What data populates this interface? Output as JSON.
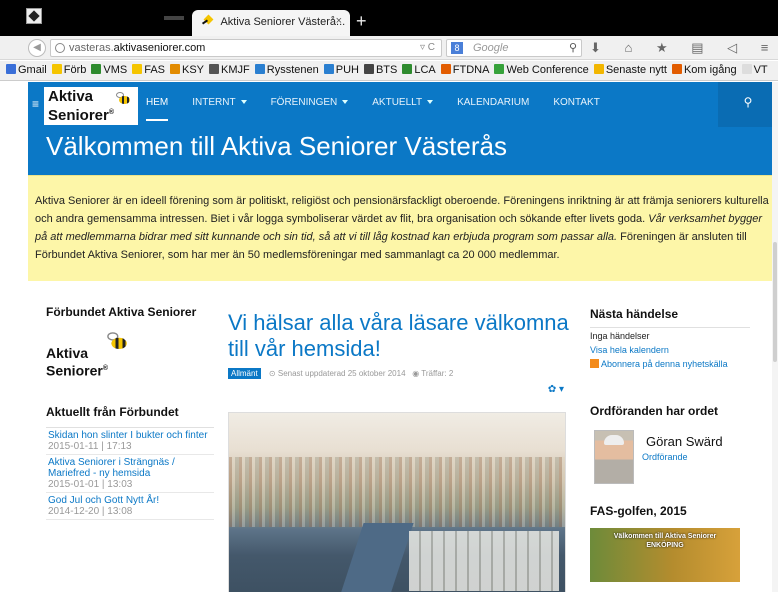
{
  "browser": {
    "tab_title": "Aktiva Seniorer Västerå...",
    "tab_close": "×",
    "new_tab": "+",
    "url_prefix": "vasteras.",
    "url_domain": "aktivaseniorer.com",
    "url_right": "▿ C",
    "search_placeholder": "Google",
    "search_engine_letter": "8",
    "tool_icons": "⬇ ⌂ ★ ▤ ◁ ≡"
  },
  "bookmarks": [
    {
      "label": "Gmail",
      "color": "#3a6fd8"
    },
    {
      "label": "Förb",
      "color": "#f5c500"
    },
    {
      "label": "VMS",
      "color": "#2e8b2e"
    },
    {
      "label": "FAS",
      "color": "#f5c500"
    },
    {
      "label": "KSY",
      "color": "#e28b00"
    },
    {
      "label": "KMJF",
      "color": "#555555"
    },
    {
      "label": "Rysstenen",
      "color": "#2a7fd0"
    },
    {
      "label": "PUH",
      "color": "#2a7fd0"
    },
    {
      "label": "BTS",
      "color": "#444444"
    },
    {
      "label": "LCA",
      "color": "#2e8b2e"
    },
    {
      "label": "FTDNA",
      "color": "#e25c00"
    },
    {
      "label": "Web Conference",
      "color": "#36a23a"
    },
    {
      "label": "Senaste nytt",
      "color": "#f2b600"
    },
    {
      "label": "Kom igång",
      "color": "#e25c00"
    },
    {
      "label": "VT",
      "color": "#dddddd"
    }
  ],
  "site": {
    "logo_line1": "Aktiva",
    "logo_line2": "Seniorer",
    "logo_reg": "®",
    "menu": [
      {
        "label": "HEM",
        "dropdown": false
      },
      {
        "label": "INTERNT",
        "dropdown": true
      },
      {
        "label": "FÖRENINGEN",
        "dropdown": true
      },
      {
        "label": "AKTUELLT",
        "dropdown": true
      },
      {
        "label": "KALENDARIUM",
        "dropdown": false
      },
      {
        "label": "KONTAKT",
        "dropdown": false
      }
    ],
    "search_icon": "magnifier-icon",
    "banner_title": "Välkommen till Aktiva Seniorer Västerås",
    "intro_normal": "Aktiva Seniorer är en ideell förening som är politiskt, religiöst och pensionärsfackligt oberoende. Föreningens inriktning är att främja seniorers kulturella och andra gemensamma intressen. Biet i vår logga symboliserar värdet av flit, bra organisation och sökande efter livets goda.",
    "intro_italic": "Vår verksamhet bygger på att medlemmarna bidrar med sitt kunnande och sin tid, så att vi till låg kostnad kan erbjuda program som passar alla.",
    "intro_tail": "Föreningen är ansluten till Förbundet Aktiva Seniorer, som har mer än 50 medlemsföreningar med sammanlagt ca 20 000 medlemmar."
  },
  "left": {
    "title": "Förbundet Aktiva Seniorer",
    "news_title": "Aktuellt från Förbundet",
    "news": [
      {
        "title": "Skidan hon slinter I bukter och finter",
        "date": "2015-01-11 | 17:13"
      },
      {
        "title": "Aktiva Seniorer i Strängnäs / Mariefred - ny hemsida",
        "date": "2015-01-01 | 13:03"
      },
      {
        "title": "God Jul och Gott Nytt År!",
        "date": "2014-12-20 | 13:08"
      }
    ]
  },
  "article": {
    "title": "Vi hälsar alla våra läsare välkomna till vår hemsida!",
    "category": "Allmänt",
    "updated": "Senast uppdaterad 25 oktober 2014",
    "hits": "Träffar: 2"
  },
  "right": {
    "next_title": "Nästa händelse",
    "no_events": "Inga händelser",
    "calendar_link": "Visa hela kalendern",
    "subscribe_link": "Abonnera på denna nyhetskälla",
    "chair_title": "Ordföranden har ordet",
    "chair_name": "Göran Swärd",
    "chair_role": "Ordförande",
    "golf_title": "FAS-golfen, 2015",
    "golf_image_text": "Välkommen till Aktiva Seniorer ENKÖPING"
  }
}
